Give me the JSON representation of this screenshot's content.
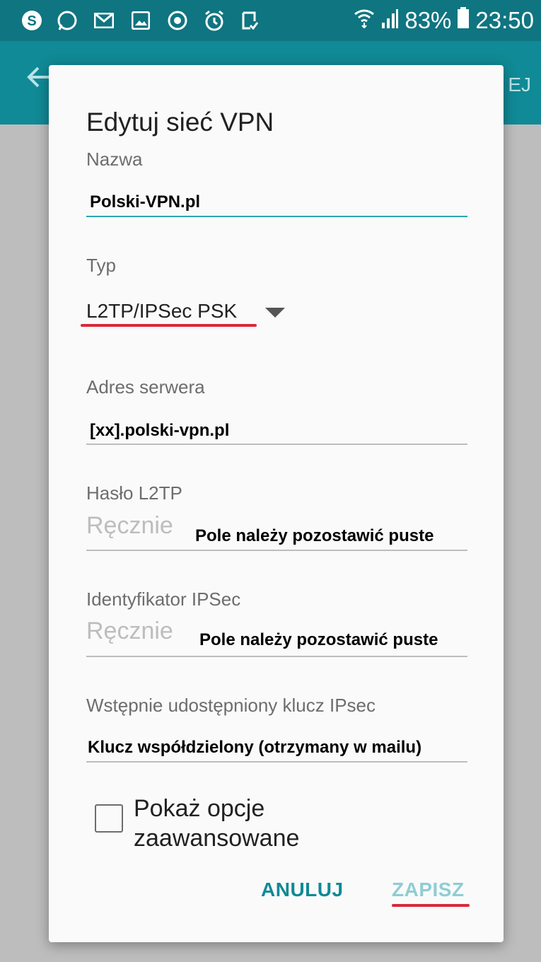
{
  "status_bar": {
    "left_icons": [
      "skype-icon",
      "whatsapp-icon",
      "mail-icon",
      "gallery-icon",
      "sync-icon",
      "alarm-icon",
      "clipboard-icon"
    ],
    "battery": "83%",
    "time": "23:50"
  },
  "app_bar": {
    "action_label": "EJ"
  },
  "dialog": {
    "title": "Edytuj sieć VPN",
    "name_label": "Nazwa",
    "name_value": "Polski-VPN.pl",
    "type_label": "Typ",
    "type_value": "L2TP/IPSec PSK",
    "server_label": "Adres serwera",
    "server_value": "[xx].polski-vpn.pl",
    "l2tp_label": "Hasło L2TP",
    "l2tp_placeholder": "Ręcznie",
    "l2tp_note": "Pole należy pozostawić puste",
    "ipsec_id_label": "Identyfikator IPSec",
    "ipsec_id_placeholder": "Ręcznie",
    "ipsec_id_note": "Pole należy pozostawić puste",
    "psk_label": "Wstępnie udostępniony klucz IPsec",
    "psk_value": "Klucz współdzielony (otrzymany w mailu)",
    "advanced_label": "Pokaż opcje zaawansowane",
    "cancel_label": "ANULUJ",
    "save_label": "ZAPISZ"
  },
  "colors": {
    "status_bar": "#0f7580",
    "app_bar": "#108a96",
    "accent": "#2aa6b4",
    "annotation": "#d8293a"
  }
}
